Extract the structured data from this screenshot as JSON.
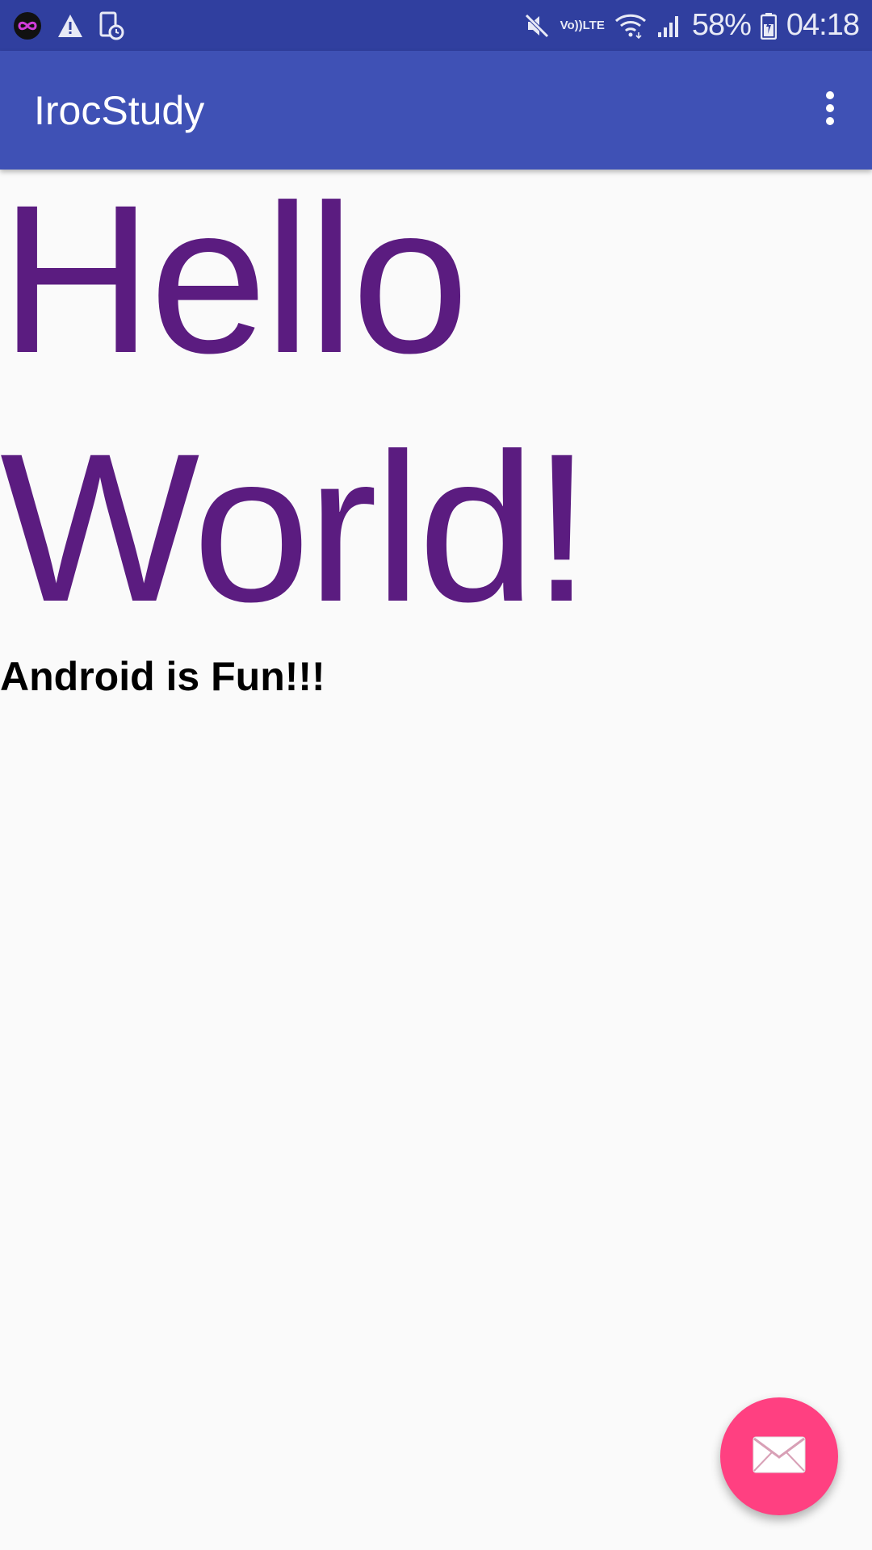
{
  "status_bar": {
    "battery": "58%",
    "time": "04:18",
    "volte_top": "Vo))",
    "volte_bottom": "LTE",
    "icons_left": [
      "infinity-app-icon",
      "warning-icon",
      "device-schedule-icon"
    ],
    "icons_right": [
      "mute-icon",
      "volte-icon",
      "wifi-icon",
      "signal-icon",
      "battery-icon"
    ]
  },
  "app_bar": {
    "title": "IrocStudy",
    "menu_icon": "more-vert-icon",
    "color": "#3f51b5"
  },
  "main": {
    "headline": "Hello World!",
    "headline_color": "#5b1c80",
    "subtitle": "Android is Fun!!!"
  },
  "fab": {
    "icon": "email-icon",
    "color": "#ff4081"
  },
  "colors": {
    "status_bar": "#303f9f",
    "background": "#fafafa"
  }
}
